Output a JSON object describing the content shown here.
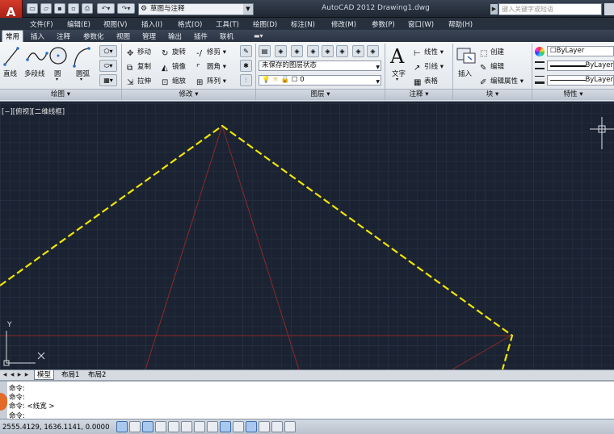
{
  "app": {
    "logo": "A",
    "title": "AutoCAD 2012    Drawing1.dwg",
    "workspace": "草图与注释",
    "search_placeholder": "键入关键字或短语"
  },
  "menu": [
    "文件(F)",
    "编辑(E)",
    "视图(V)",
    "插入(I)",
    "格式(O)",
    "工具(T)",
    "绘图(D)",
    "标注(N)",
    "修改(M)",
    "参数(P)",
    "窗口(W)",
    "帮助(H)"
  ],
  "tabs": [
    "常用",
    "插入",
    "注释",
    "参数化",
    "视图",
    "管理",
    "输出",
    "插件",
    "联机"
  ],
  "draw": {
    "line": "直线",
    "polyline": "多段线",
    "circle": "圆",
    "arc": "圆弧",
    "panel": "绘图"
  },
  "modify": {
    "move": "移动",
    "rotate": "旋转",
    "trim": "修剪",
    "copy": "复制",
    "mirror": "镜像",
    "fillet": "圆角",
    "stretch": "拉伸",
    "scale": "缩放",
    "array": "阵列",
    "panel": "修改"
  },
  "layer": {
    "state": "未保存的图层状态",
    "current": "0",
    "panel": "图层"
  },
  "annotation": {
    "text": "文字",
    "linear": "线性",
    "leader": "引线",
    "table": "表格",
    "panel": "注释"
  },
  "block": {
    "insert": "插入",
    "create": "创建",
    "edit": "编辑",
    "edit_attr": "编辑属性",
    "panel": "块"
  },
  "properties": {
    "color": "ByLayer",
    "linetype": "ByLayer",
    "lineweight": "ByLayer",
    "panel": "特性"
  },
  "viewport": {
    "label": "[−][俯视][二维线框]"
  },
  "ucs": {
    "x": "X",
    "y": "Y"
  },
  "layouts": [
    "模型",
    "布局1",
    "布局2"
  ],
  "command": {
    "lines": [
      "命令:",
      "命令:",
      "命令:  <线宽 >",
      "命令:"
    ]
  },
  "status": {
    "coords": "2555.4129, 1636.1141, 0.0000"
  },
  "colors": {
    "canvas": "#1b2332",
    "dashed_line": "#f2e600",
    "construction_line": "#8b2a2a"
  }
}
